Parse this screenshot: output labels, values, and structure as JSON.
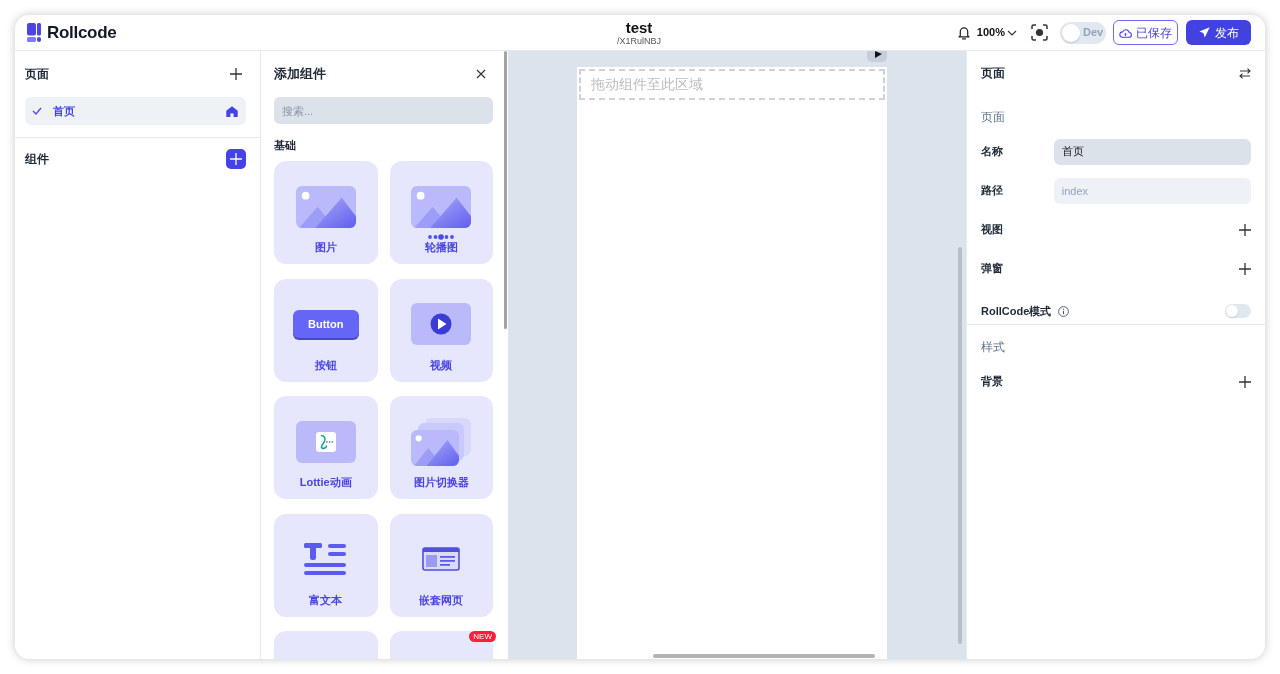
{
  "header": {
    "logo": "Rollcode",
    "title": "test",
    "subtitle": "/X1RulNBJ",
    "zoom": "100%",
    "dev_toggle": {
      "label": "Dev",
      "on": false
    },
    "save_button": "已保存",
    "publish_button": "发布"
  },
  "pages_sidebar": {
    "pages_title": "页面",
    "pages": [
      {
        "label": "首页",
        "selected": true,
        "home": true
      }
    ],
    "components_title": "组件"
  },
  "component_panel": {
    "title": "添加组件",
    "search": {
      "placeholder": "搜索..."
    },
    "group_title": "基础",
    "cards": [
      {
        "kind": "image",
        "label": "图片"
      },
      {
        "kind": "carousel",
        "label": "轮播图"
      },
      {
        "kind": "button",
        "preview": "Button",
        "label": "按钮"
      },
      {
        "kind": "video",
        "label": "视频"
      },
      {
        "kind": "lottie",
        "label": "Lottie动画"
      },
      {
        "kind": "image-switcher",
        "label": "图片切换器"
      },
      {
        "kind": "rich-text",
        "label": "富文本"
      },
      {
        "kind": "webpage",
        "label": "嵌套网页"
      },
      {
        "kind": "cropped"
      },
      {
        "kind": "cropped",
        "badge": "NEW"
      }
    ]
  },
  "canvas": {
    "drop_zone": "拖动组件至此区域"
  },
  "properties": {
    "title": "页面",
    "sections": [
      {
        "title": "页面",
        "rows": [
          {
            "kind": "field",
            "label": "名称",
            "value": "首页"
          },
          {
            "kind": "field",
            "label": "路径",
            "placeholder": "index"
          },
          {
            "kind": "add",
            "label": "视图"
          },
          {
            "kind": "add",
            "label": "弹窗"
          },
          {
            "kind": "toggle",
            "label": "RollCode模式",
            "on": false
          }
        ]
      },
      {
        "title": "样式",
        "rows": [
          {
            "kind": "add",
            "label": "背景"
          }
        ]
      }
    ]
  }
}
